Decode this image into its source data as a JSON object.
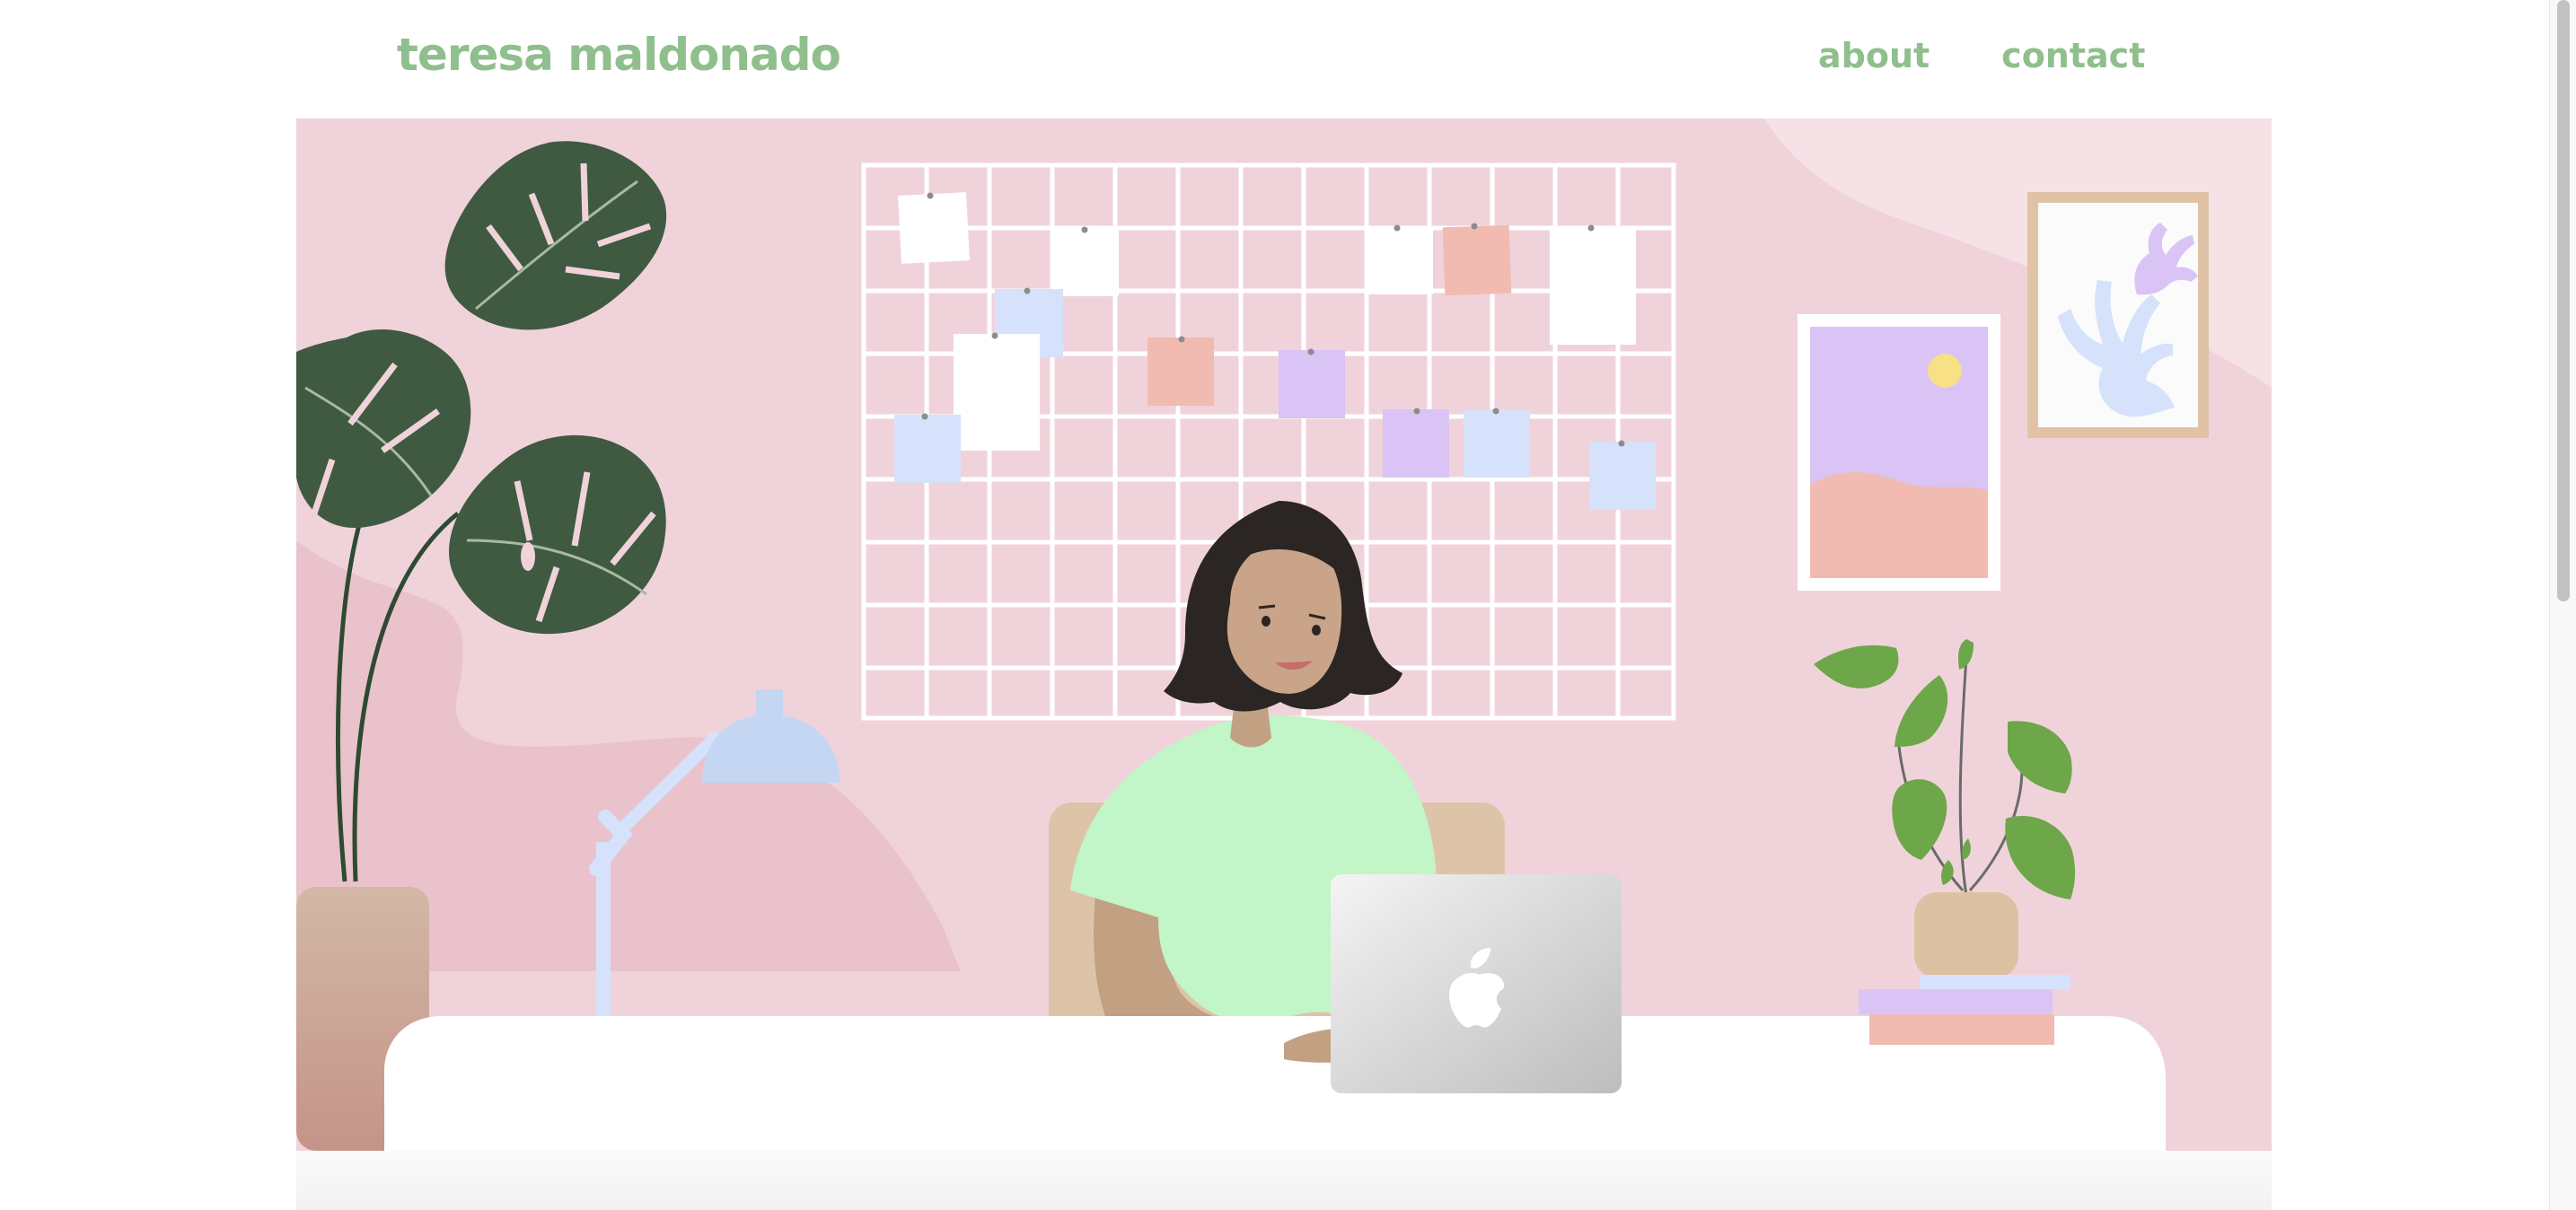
{
  "header": {
    "site_title": "teresa maldonado",
    "nav": [
      {
        "label": "about"
      },
      {
        "label": "contact"
      }
    ]
  },
  "hero": {
    "icons": [
      "monstera-plant-icon",
      "desk-lamp-icon",
      "grid-memo-board-icon",
      "sticky-note-icon",
      "framed-landscape-icon",
      "framed-coral-print-icon",
      "potted-plant-icon",
      "stacked-books-icon",
      "woman-illustration-icon",
      "chair-icon",
      "laptop-icon",
      "apple-logo-icon"
    ]
  },
  "colors": {
    "brand_green": "#8fbf8d",
    "wall_pink": "#f0d3da",
    "blob_pink": "#eac2cc",
    "desk_white": "#ffffff",
    "monstera_green": "#3f5a41",
    "plant_green": "#6ea64a",
    "shirt_green": "#c2f5c8",
    "hair": "#2b2624",
    "skin": "#c9a489",
    "note_white": "#ffffff",
    "note_blue": "#d6e2fb",
    "note_peach": "#f2bbb1",
    "note_lilac": "#dac4f5"
  }
}
